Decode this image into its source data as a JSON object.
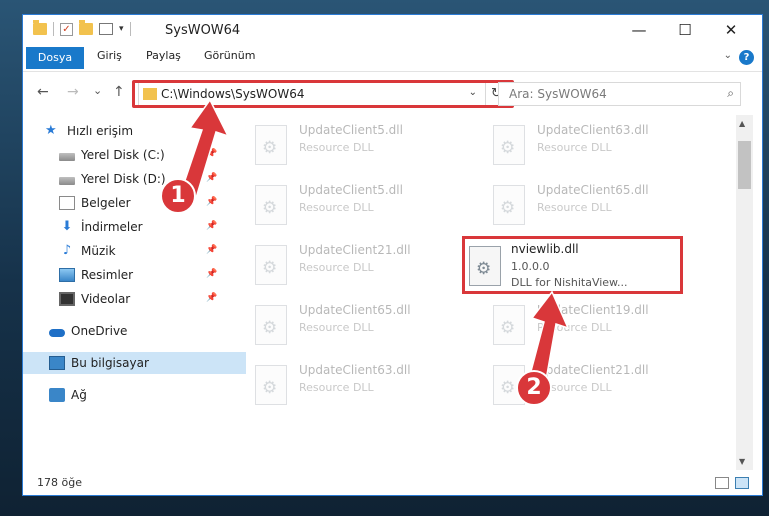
{
  "window": {
    "title": "SysWOW64",
    "minimize": "—",
    "maximize": "☐",
    "close": "✕"
  },
  "ribbon": {
    "file": "Dosya",
    "tabs": [
      "Giriş",
      "Paylaş",
      "Görünüm"
    ],
    "help": "?"
  },
  "address": {
    "path": "C:\\Windows\\SysWOW64",
    "refresh": "↻"
  },
  "search": {
    "placeholder": "Ara: SysWOW64"
  },
  "nav_buttons": {
    "back": "←",
    "forward": "→",
    "recent": "⌄",
    "up": "↑"
  },
  "sidebar": {
    "items": [
      {
        "label": "Hızlı erişim",
        "icon": "star-icon"
      },
      {
        "label": "Yerel Disk (C:)",
        "icon": "disk-icon",
        "pinned": true
      },
      {
        "label": "Yerel Disk (D:)",
        "icon": "disk-icon",
        "pinned": true
      },
      {
        "label": "Belgeler",
        "icon": "document-icon",
        "pinned": true
      },
      {
        "label": "İndirmeler",
        "icon": "download-icon",
        "pinned": true
      },
      {
        "label": "Müzik",
        "icon": "music-icon",
        "pinned": true
      },
      {
        "label": "Resimler",
        "icon": "pictures-icon",
        "pinned": true
      },
      {
        "label": "Videolar",
        "icon": "videos-icon",
        "pinned": true
      },
      {
        "label": "OneDrive",
        "icon": "onedrive-icon"
      },
      {
        "label": "Bu bilgisayar",
        "icon": "computer-icon",
        "selected": true
      },
      {
        "label": "Ağ",
        "icon": "network-icon"
      }
    ]
  },
  "files": [
    {
      "name": "UpdateClient5.dll",
      "desc": "Resource DLL"
    },
    {
      "name": "UpdateClient63.dll",
      "desc": "Resource DLL"
    },
    {
      "name": "UpdateClient5.dll",
      "desc": "Resource DLL"
    },
    {
      "name": "UpdateClient65.dll",
      "desc": "Resource DLL"
    },
    {
      "name": "UpdateClient21.dll",
      "desc": "Resource DLL"
    },
    {
      "name": "UpdateClient65.dll",
      "desc": "Resource DLL"
    },
    {
      "name": "UpdateClient19.dll",
      "desc": "Resource DLL"
    },
    {
      "name": "UpdateClient63.dll",
      "desc": "Resource DLL"
    },
    {
      "name": "UpdateClient21.dll",
      "desc": "Resource DLL"
    }
  ],
  "highlighted_file": {
    "name": "nviewlib.dll",
    "version": "1.0.0.0",
    "desc": "DLL for NishitaView..."
  },
  "status": {
    "count": "178 öğe"
  },
  "annotations": {
    "step1": "1",
    "step2": "2"
  },
  "colors": {
    "accent": "#1979ca",
    "highlight": "#d9373a",
    "selected": "#cce4f7"
  }
}
